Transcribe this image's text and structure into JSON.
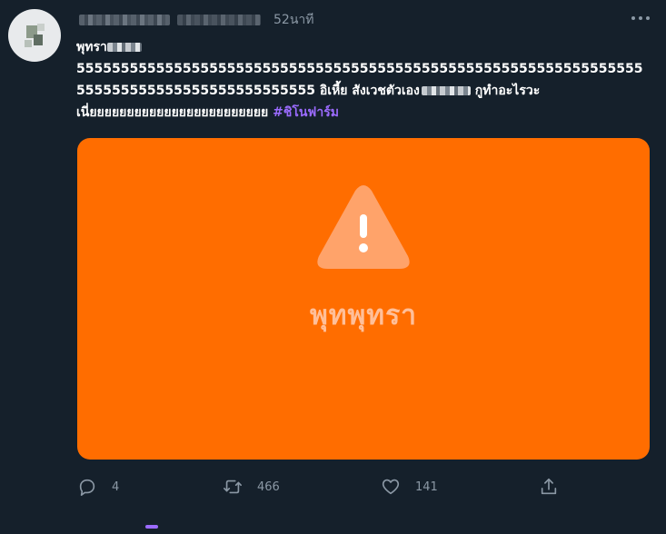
{
  "tweet": {
    "time": "52นาที",
    "text_line1": "พุทรา",
    "text_line2": "5555555555555555555555555555555555555555555555555555555555555555",
    "text_line3a": "555555555555555555555555555 อิเหี้ย สังเวชตัวเอง",
    "text_line3b": " กูทำอะไรวะ",
    "text_line4": "เนี่ยยยยยยยยยยยยยยยยยยยยยยยย ",
    "hashtag": "#ชิโนฟาร์ม"
  },
  "media": {
    "caption": "พุทพุทรา",
    "background": "#ff6d00",
    "icon": "warning-triangle-icon"
  },
  "actions": {
    "reply_count": "4",
    "retweet_count": "466",
    "like_count": "141"
  },
  "colors": {
    "background": "#15202b",
    "muted": "#8b98a5",
    "hashtag": "#9b6bff"
  }
}
